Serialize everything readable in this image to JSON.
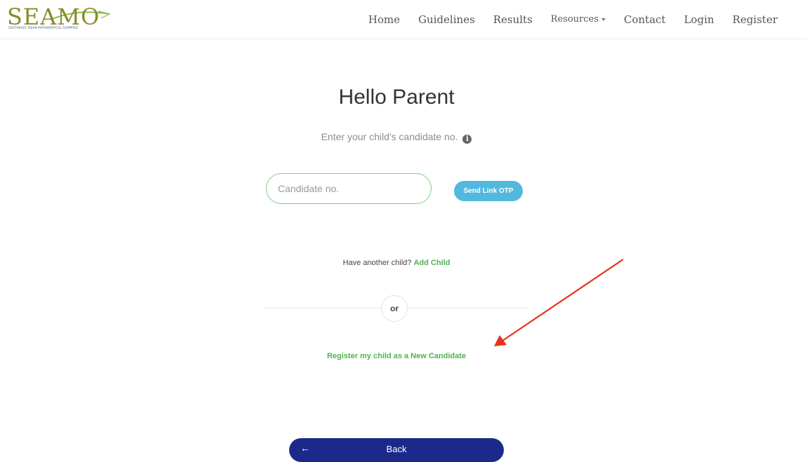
{
  "navbar": {
    "logo_text": "SEAMO",
    "logo_tagline": "SOUTHEAST ASIAN MATHEMATICAL OLYMPIAD",
    "items": [
      {
        "label": "Home"
      },
      {
        "label": "Guidelines"
      },
      {
        "label": "Results"
      },
      {
        "label": "Resources"
      },
      {
        "label": "Contact"
      },
      {
        "label": "Login"
      },
      {
        "label": "Register"
      }
    ]
  },
  "main": {
    "title": "Hello Parent",
    "subtitle": "Enter your child's candidate no.",
    "candidate_input": {
      "placeholder": "Candidate no.",
      "value": ""
    },
    "otp_button": "Send Link OTP",
    "another_child_text": "Have another child?",
    "add_child_link": "Add Child",
    "divider_text": "or",
    "register_link": "Register my child as a New Candidate",
    "back_button": "Back"
  },
  "colors": {
    "link_green": "#4fb24f",
    "otp_blue": "#52b8dd",
    "back_navy": "#1b2a8a",
    "annotation_red": "#e8321c",
    "input_border": "#7ccf8a"
  },
  "icons": [
    "info-icon",
    "dropdown-caret-icon",
    "back-arrow-icon",
    "annotation-arrow"
  ]
}
